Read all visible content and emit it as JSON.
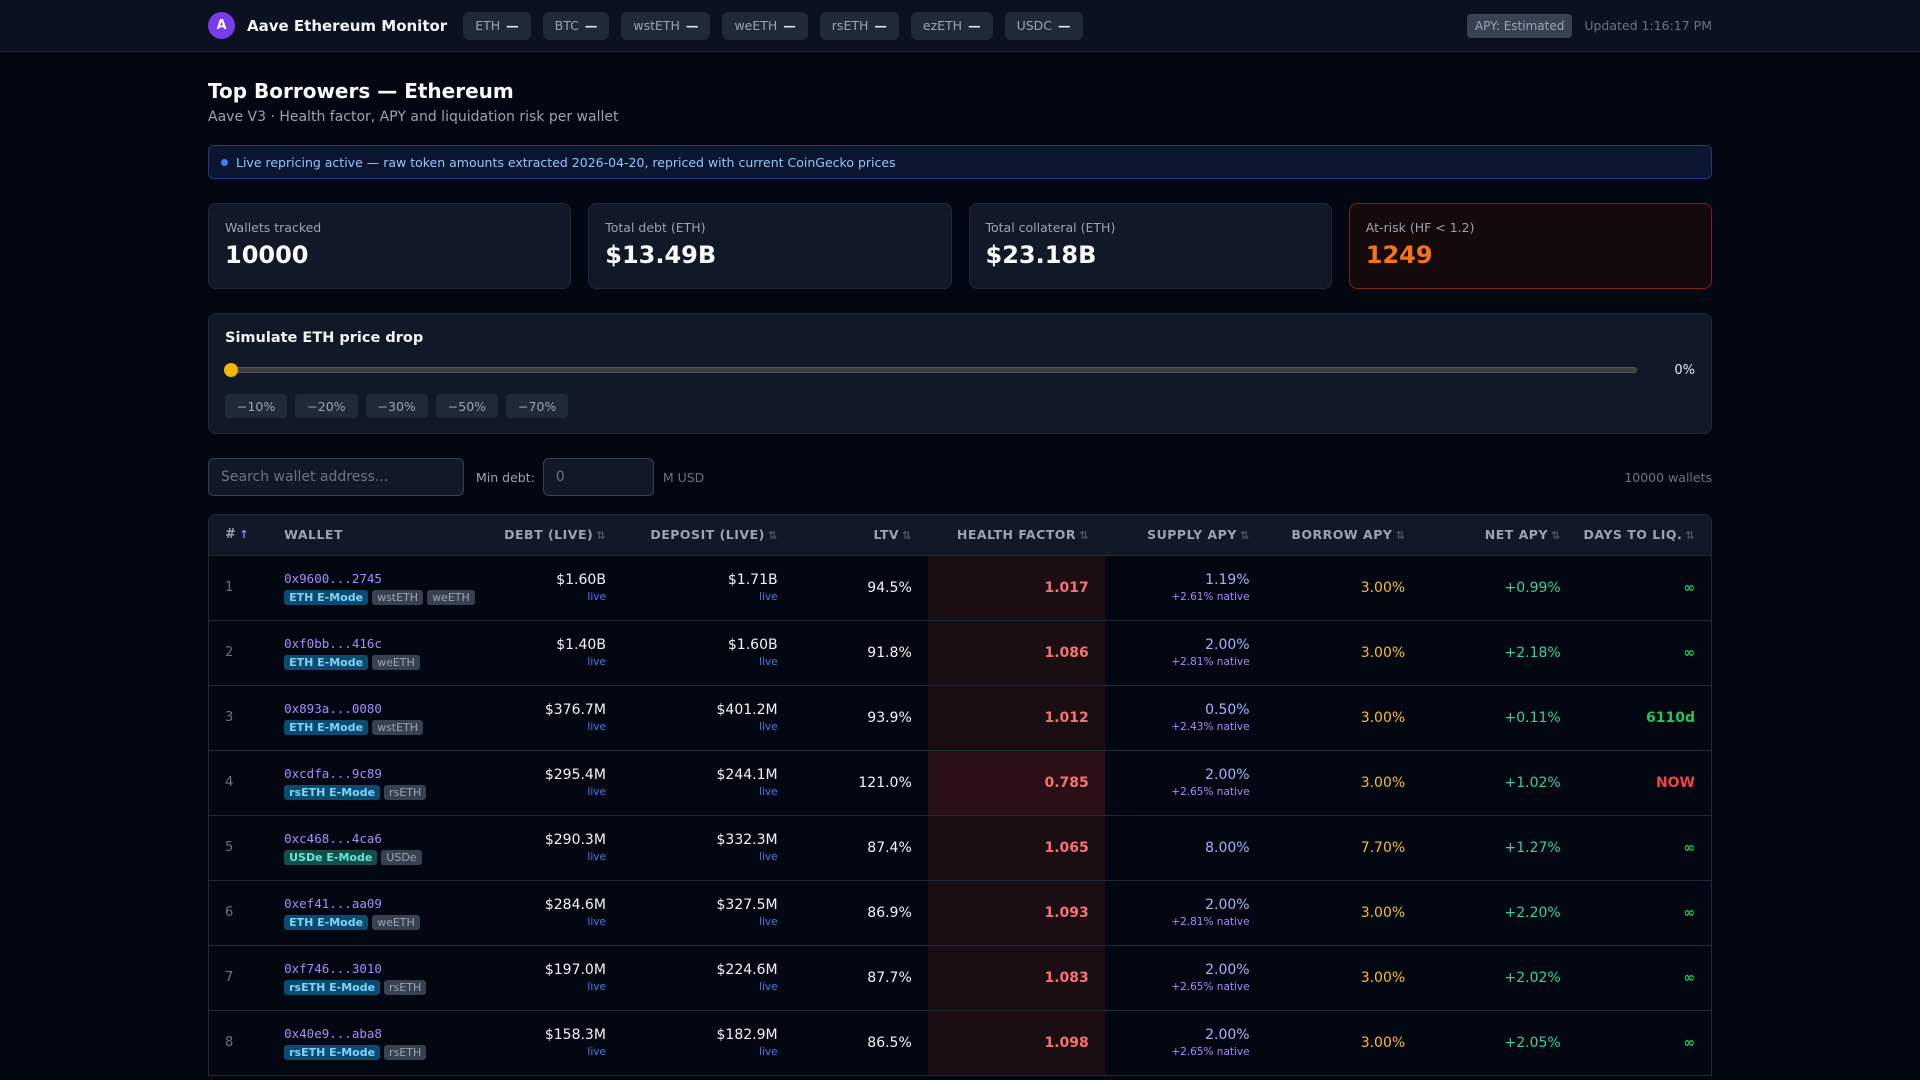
{
  "header": {
    "logo_letter": "A",
    "title": "Aave Ethereum Monitor",
    "tickers": [
      {
        "symbol": "ETH",
        "value": "—"
      },
      {
        "symbol": "BTC",
        "value": "—"
      },
      {
        "symbol": "wstETH",
        "value": "—"
      },
      {
        "symbol": "weETH",
        "value": "—"
      },
      {
        "symbol": "rsETH",
        "value": "—"
      },
      {
        "symbol": "ezETH",
        "value": "—"
      },
      {
        "symbol": "USDC",
        "value": "—"
      }
    ],
    "apy_badge": "APY: Estimated",
    "updated": "Updated 1:16:17 PM"
  },
  "page": {
    "title": "Top Borrowers — Ethereum",
    "subtitle": "Aave V3 · Health factor, APY and liquidation risk per wallet"
  },
  "banner": "Live repricing active — raw token amounts extracted 2026-04-20, repriced with current CoinGecko prices",
  "stats": {
    "wallets_label": "Wallets tracked",
    "wallets_value": "10000",
    "debt_label": "Total debt (ETH)",
    "debt_value": "$13.49B",
    "collateral_label": "Total collateral (ETH)",
    "collateral_value": "$23.18B",
    "risk_label": "At-risk (HF < 1.2)",
    "risk_value": "1249"
  },
  "simulator": {
    "title": "Simulate ETH price drop",
    "value_label": "0%",
    "value_fraction": 0,
    "presets": [
      "−10%",
      "−20%",
      "−30%",
      "−50%",
      "−70%"
    ]
  },
  "filters": {
    "search_placeholder": "Search wallet address...",
    "min_debt_label": "Min debt:",
    "min_debt_placeholder": "0",
    "unit": "M USD",
    "count": "10000 wallets"
  },
  "table": {
    "columns": {
      "idx": "#",
      "idx_sort": "↑",
      "wallet": "Wallet",
      "debt": "Debt (live)",
      "deposit": "Deposit (live)",
      "ltv": "LTV",
      "hf": "Health Factor",
      "supply": "Supply APY",
      "borrow": "Borrow APY",
      "net": "Net APY",
      "days": "Days to Liq.",
      "sort_icon": "⇅"
    },
    "rows": [
      {
        "idx": "1",
        "wallet": "0x9600...2745",
        "mode": "ETH E-Mode",
        "assets": [
          "wstETH",
          "weETH"
        ],
        "debt": "$1.60B",
        "debt_sub": "live",
        "deposit": "$1.71B",
        "deposit_sub": "live",
        "ltv": "94.5%",
        "hf": "1.017",
        "supply": "1.19%",
        "supply_sub": "+2.61% native",
        "borrow": "3.00%",
        "net": "+0.99%",
        "days": "∞"
      },
      {
        "idx": "2",
        "wallet": "0xf0bb...416c",
        "mode": "ETH E-Mode",
        "assets": [
          "weETH"
        ],
        "debt": "$1.40B",
        "debt_sub": "live",
        "deposit": "$1.60B",
        "deposit_sub": "live",
        "ltv": "91.8%",
        "hf": "1.086",
        "supply": "2.00%",
        "supply_sub": "+2.81% native",
        "borrow": "3.00%",
        "net": "+2.18%",
        "days": "∞"
      },
      {
        "idx": "3",
        "wallet": "0x893a...0080",
        "mode": "ETH E-Mode",
        "assets": [
          "wstETH"
        ],
        "debt": "$376.7M",
        "debt_sub": "live",
        "deposit": "$401.2M",
        "deposit_sub": "live",
        "ltv": "93.9%",
        "hf": "1.012",
        "supply": "0.50%",
        "supply_sub": "+2.43% native",
        "borrow": "3.00%",
        "net": "+0.11%",
        "days": "6110d"
      },
      {
        "idx": "4",
        "wallet": "0xcdfa...9c89",
        "mode": "rsETH E-Mode",
        "assets": [
          "rsETH"
        ],
        "debt": "$295.4M",
        "debt_sub": "live",
        "deposit": "$244.1M",
        "deposit_sub": "live",
        "ltv": "121.0%",
        "hf": "0.785",
        "supply": "2.00%",
        "supply_sub": "+2.65% native",
        "borrow": "3.00%",
        "net": "+1.02%",
        "days": "NOW"
      },
      {
        "idx": "5",
        "wallet": "0xc468...4ca6",
        "mode": "USDe E-Mode",
        "assets": [
          "USDe"
        ],
        "debt": "$290.3M",
        "debt_sub": "live",
        "deposit": "$332.3M",
        "deposit_sub": "live",
        "ltv": "87.4%",
        "hf": "1.065",
        "supply": "8.00%",
        "supply_sub": "",
        "borrow": "7.70%",
        "net": "+1.27%",
        "days": "∞"
      },
      {
        "idx": "6",
        "wallet": "0xef41...aa09",
        "mode": "ETH E-Mode",
        "assets": [
          "weETH"
        ],
        "debt": "$284.6M",
        "debt_sub": "live",
        "deposit": "$327.5M",
        "deposit_sub": "live",
        "ltv": "86.9%",
        "hf": "1.093",
        "supply": "2.00%",
        "supply_sub": "+2.81% native",
        "borrow": "3.00%",
        "net": "+2.20%",
        "days": "∞"
      },
      {
        "idx": "7",
        "wallet": "0xf746...3010",
        "mode": "rsETH E-Mode",
        "assets": [
          "rsETH"
        ],
        "debt": "$197.0M",
        "debt_sub": "live",
        "deposit": "$224.6M",
        "deposit_sub": "live",
        "ltv": "87.7%",
        "hf": "1.083",
        "supply": "2.00%",
        "supply_sub": "+2.65% native",
        "borrow": "3.00%",
        "net": "+2.02%",
        "days": "∞"
      },
      {
        "idx": "8",
        "wallet": "0x40e9...aba8",
        "mode": "rsETH E-Mode",
        "assets": [
          "rsETH"
        ],
        "debt": "$158.3M",
        "debt_sub": "live",
        "deposit": "$182.9M",
        "deposit_sub": "live",
        "ltv": "86.5%",
        "hf": "1.098",
        "supply": "2.00%",
        "supply_sub": "+2.65% native",
        "borrow": "3.00%",
        "net": "+2.05%",
        "days": "∞"
      }
    ]
  }
}
